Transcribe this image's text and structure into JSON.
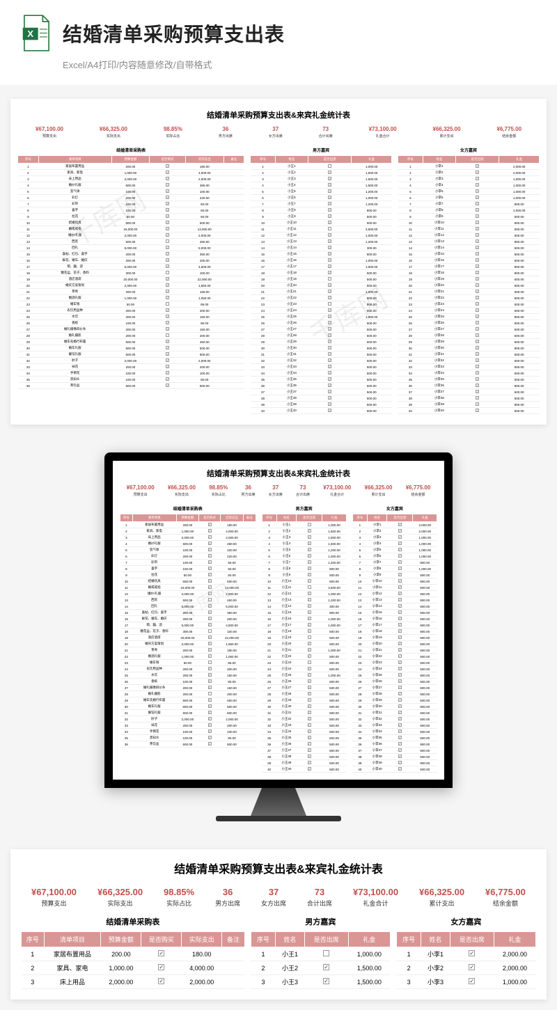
{
  "hero": {
    "title": "结婚清单采购预算支出表",
    "subtitle": "Excel/A4打印/内容随意修改/自带格式"
  },
  "doc": {
    "title": "结婚清单采购预算支出表&来宾礼金统计表"
  },
  "summary": [
    {
      "val": "¥67,100.00",
      "lbl": "预算支出"
    },
    {
      "val": "¥66,325.00",
      "lbl": "实际支出"
    },
    {
      "val": "98.85%",
      "lbl": "实际占比"
    },
    {
      "val": "36",
      "lbl": "男方出席"
    },
    {
      "val": "37",
      "lbl": "女方出席"
    },
    {
      "val": "73",
      "lbl": "合计出席"
    },
    {
      "val": "¥73,100.00",
      "lbl": "礼金合计"
    },
    {
      "val": "¥66,325.00",
      "lbl": "累计支出"
    },
    {
      "val": "¥6,775.00",
      "lbl": "结余金额"
    }
  ],
  "purchase": {
    "caption": "结婚清单采购表",
    "headers": [
      "序号",
      "清单项目",
      "预算金额",
      "是否购买",
      "实际支出",
      "备注"
    ],
    "rows": [
      [
        "1",
        "家居布置用品",
        "200.00",
        "on",
        "180.00",
        ""
      ],
      [
        "2",
        "家具、家电",
        "1,000.00",
        "on",
        "4,000.00",
        ""
      ],
      [
        "3",
        "床上用品",
        "2,000.00",
        "on",
        "2,000.00",
        ""
      ],
      [
        "4",
        "婚纱礼服",
        "500.00",
        "on",
        "480.00",
        ""
      ],
      [
        "5",
        "氢气球",
        "100.00",
        "on",
        "100.00",
        ""
      ],
      [
        "6",
        "彩灯",
        "200.00",
        "on",
        "220.00",
        ""
      ],
      [
        "7",
        "彩带",
        "100.00",
        "on",
        "50.00",
        ""
      ],
      [
        "8",
        "喜字",
        "100.00",
        "on",
        "50.00",
        ""
      ],
      [
        "9",
        "拉花",
        "50.00",
        "on",
        "50.00",
        ""
      ],
      [
        "10",
        "结婚玩具",
        "500.00",
        "on",
        "500.00",
        ""
      ],
      [
        "11",
        "婚戒戒指",
        "15,000.00",
        "on",
        "13,000.00",
        ""
      ],
      [
        "12",
        "婚纱/礼服",
        "2,000.00",
        "on",
        "2,000.00",
        ""
      ],
      [
        "13",
        "西装",
        "500.00",
        "",
        "450.00",
        ""
      ],
      [
        "14",
        "回礼",
        "5,000.00",
        "on",
        "5,000.00",
        ""
      ],
      [
        "15",
        "喜帖、红包、喜字",
        "200.00",
        "on",
        "350.00",
        ""
      ],
      [
        "16",
        "鲜花、婚车、婚庆",
        "200.00",
        "on",
        "200.00",
        ""
      ],
      [
        "17",
        "萌、囍、迎",
        "5,000.00",
        "on",
        "4,500.00",
        ""
      ],
      [
        "18",
        "糖花盆、花子、香料",
        "300.00",
        "",
        "100.00",
        ""
      ],
      [
        "19",
        "酒店酒席",
        "20,000.00",
        "on",
        "22,000.00",
        ""
      ],
      [
        "20",
        "婚庆方案策划",
        "2,000.00",
        "on",
        "1,650.00",
        ""
      ],
      [
        "21",
        "茶青",
        "200.00",
        "on",
        "180.00",
        ""
      ],
      [
        "22",
        "婚酒礼服",
        "1,000.00",
        "on",
        "1,050.00",
        ""
      ],
      [
        "23",
        "婚车钱",
        "50.00",
        "",
        "85.00",
        ""
      ],
      [
        "24",
        "农饮用品种",
        "200.00",
        "on",
        "200.00",
        ""
      ],
      [
        "25",
        "水饮",
        "200.00",
        "on",
        "150.00",
        ""
      ],
      [
        "26",
        "香槟",
        "100.00",
        "on",
        "80.00",
        ""
      ],
      [
        "27",
        "婚礼摄像四价条",
        "200.00",
        "on",
        "150.00",
        ""
      ],
      [
        "28",
        "婚礼摄影",
        "200.00",
        "",
        "200.00",
        ""
      ],
      [
        "29",
        "婚车先婚行布置",
        "500.00",
        "on",
        "450.00",
        ""
      ],
      [
        "30",
        "婚车礼服",
        "500.00",
        "on",
        "500.00",
        ""
      ],
      [
        "31",
        "餐馆礼服",
        "500.00",
        "on",
        "600.00",
        ""
      ],
      [
        "32",
        "肘子",
        "2,000.00",
        "on",
        "2,000.00",
        ""
      ],
      [
        "33",
        "袜花",
        "200.00",
        "on",
        "200.00",
        ""
      ],
      [
        "34",
        "手倒花",
        "100.00",
        "on",
        "100.00",
        ""
      ],
      [
        "35",
        "黑知众",
        "100.00",
        "on",
        "80.00",
        ""
      ],
      [
        "36",
        "茶饮品",
        "500.00",
        "on",
        "500.00",
        ""
      ]
    ]
  },
  "male": {
    "caption": "男方嘉宾",
    "headers": [
      "序号",
      "姓名",
      "是否出席",
      "礼金"
    ],
    "rows": [
      [
        "1",
        "小王1",
        "",
        "1,000.00"
      ],
      [
        "2",
        "小王2",
        "on",
        "1,500.00"
      ],
      [
        "3",
        "小王3",
        "on",
        "1,500.00"
      ],
      [
        "4",
        "小王4",
        "on",
        "1,500.00"
      ],
      [
        "5",
        "小王5",
        "on",
        "1,200.00"
      ],
      [
        "6",
        "小王6",
        "on",
        "1,000.00"
      ],
      [
        "7",
        "小王7",
        "on",
        "1,200.00"
      ],
      [
        "8",
        "小王8",
        "on",
        "800.00"
      ],
      [
        "9",
        "小王9",
        "on",
        "500.00"
      ],
      [
        "10",
        "小王10",
        "on",
        "500.00"
      ],
      [
        "11",
        "小王11",
        "",
        "3,500.00"
      ],
      [
        "12",
        "小王12",
        "on",
        "1,000.00"
      ],
      [
        "13",
        "小王13",
        "on",
        "1,200.00"
      ],
      [
        "14",
        "小王14",
        "on",
        "300.00"
      ],
      [
        "15",
        "小王15",
        "on",
        "800.00"
      ],
      [
        "16",
        "小王16",
        "on",
        "1,000.00"
      ],
      [
        "17",
        "小王17",
        "on",
        "1,000.00"
      ],
      [
        "18",
        "小王18",
        "on",
        "500.00"
      ],
      [
        "19",
        "小王19",
        "",
        "500.00"
      ],
      [
        "20",
        "小王20",
        "on",
        "500.00"
      ],
      [
        "21",
        "小王21",
        "on",
        "1,000.00"
      ],
      [
        "22",
        "小王22",
        "on",
        "500.00"
      ],
      [
        "23",
        "小王23",
        "",
        "800.00"
      ],
      [
        "24",
        "小王24",
        "on",
        "500.00"
      ],
      [
        "25",
        "小王25",
        "on",
        "1,000.00"
      ],
      [
        "26",
        "小王26",
        "on",
        "500.00"
      ],
      [
        "27",
        "小王27",
        "on",
        "500.00"
      ],
      [
        "28",
        "小王28",
        "on",
        "500.00"
      ],
      [
        "29",
        "小王29",
        "on",
        "500.00"
      ],
      [
        "30",
        "小王30",
        "on",
        "500.00"
      ],
      [
        "31",
        "小王31",
        "on",
        "500.00"
      ],
      [
        "32",
        "小王32",
        "on",
        "500.00"
      ],
      [
        "33",
        "小王33",
        "on",
        "500.00"
      ],
      [
        "34",
        "小王34",
        "on",
        "500.00"
      ],
      [
        "35",
        "小王35",
        "on",
        "500.00"
      ],
      [
        "36",
        "小王36",
        "on",
        "500.00"
      ],
      [
        "37",
        "小王37",
        "on",
        "500.00"
      ],
      [
        "38",
        "小王38",
        "on",
        "500.00"
      ],
      [
        "39",
        "小王39",
        "on",
        "500.00"
      ],
      [
        "40",
        "小王40",
        "on",
        "500.00"
      ]
    ]
  },
  "female": {
    "caption": "女方嘉宾",
    "headers": [
      "序号",
      "姓名",
      "是否出席",
      "礼金"
    ],
    "rows": [
      [
        "1",
        "小李1",
        "on",
        "2,000.00"
      ],
      [
        "2",
        "小李2",
        "on",
        "2,000.00"
      ],
      [
        "3",
        "小李3",
        "on",
        "1,000.00"
      ],
      [
        "4",
        "小李4",
        "on",
        "1,000.00"
      ],
      [
        "5",
        "小李5",
        "on",
        "1,000.00"
      ],
      [
        "6",
        "小李6",
        "on",
        "1,000.00"
      ],
      [
        "7",
        "小李7",
        "on",
        "800.00"
      ],
      [
        "8",
        "小李8",
        "on",
        "1,000.00"
      ],
      [
        "9",
        "小李9",
        "on",
        "500.00"
      ],
      [
        "10",
        "小李10",
        "on",
        "800.00"
      ],
      [
        "11",
        "小李11",
        "on",
        "500.00"
      ],
      [
        "12",
        "小李12",
        "on",
        "500.00"
      ],
      [
        "13",
        "小李13",
        "on",
        "800.00"
      ],
      [
        "14",
        "小李14",
        "on",
        "500.00"
      ],
      [
        "15",
        "小李15",
        "on",
        "500.00"
      ],
      [
        "16",
        "小李16",
        "on",
        "500.00"
      ],
      [
        "17",
        "小李17",
        "on",
        "800.00"
      ],
      [
        "18",
        "小李18",
        "on",
        "800.00"
      ],
      [
        "19",
        "小李19",
        "on",
        "500.00"
      ],
      [
        "20",
        "小李20",
        "on",
        "500.00"
      ],
      [
        "21",
        "小李21",
        "on",
        "500.00"
      ],
      [
        "22",
        "小李22",
        "on",
        "600.00"
      ],
      [
        "23",
        "小李23",
        "on",
        "500.00"
      ],
      [
        "24",
        "小李24",
        "on",
        "500.00"
      ],
      [
        "25",
        "小李25",
        "on",
        "800.00"
      ],
      [
        "26",
        "小李26",
        "on",
        "500.00"
      ],
      [
        "27",
        "小李27",
        "on",
        "600.00"
      ],
      [
        "28",
        "小李28",
        "on",
        "500.00"
      ],
      [
        "29",
        "小李29",
        "on",
        "500.00"
      ],
      [
        "30",
        "小李30",
        "on",
        "800.00"
      ],
      [
        "31",
        "小李31",
        "on",
        "500.00"
      ],
      [
        "32",
        "小李32",
        "on",
        "500.00"
      ],
      [
        "33",
        "小李33",
        "on",
        "500.00"
      ],
      [
        "34",
        "小李34",
        "on",
        "500.00"
      ],
      [
        "35",
        "小李35",
        "on",
        "500.00"
      ],
      [
        "36",
        "小李36",
        "on",
        "800.00"
      ],
      [
        "37",
        "小李37",
        "on",
        "500.00"
      ],
      [
        "38",
        "小李38",
        "on",
        "500.00"
      ],
      [
        "39",
        "小李39",
        "on",
        "800.00"
      ],
      [
        "40",
        "小李40",
        "on",
        "500.00"
      ]
    ]
  },
  "watermark": "千库网"
}
